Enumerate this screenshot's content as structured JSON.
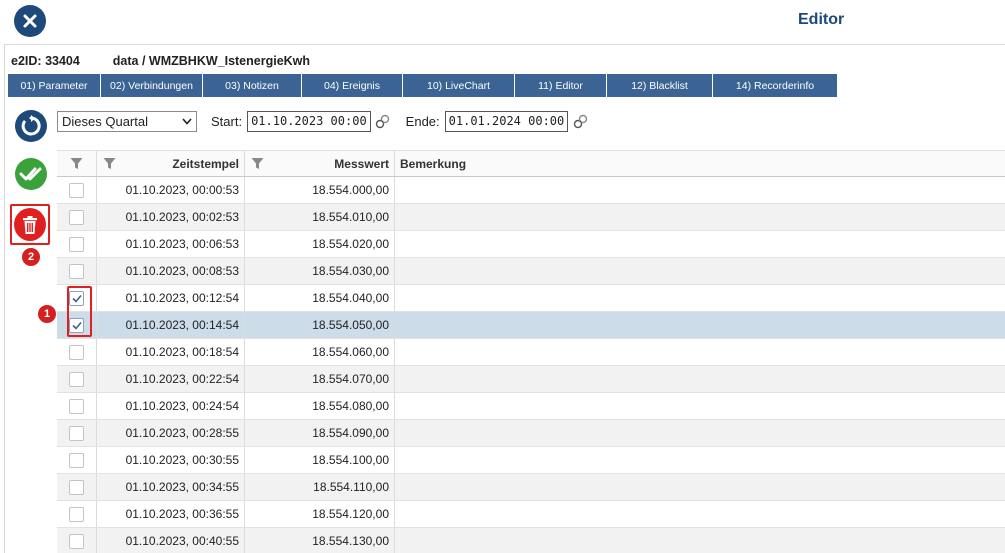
{
  "window": {
    "title": "Editor"
  },
  "record": {
    "id_label": "e2ID:",
    "id_value": "33404",
    "path": "data / WMZBHKW_IstenergieKwh"
  },
  "tabs": [
    {
      "label": "01) Parameter",
      "width": 93
    },
    {
      "label": "02) Verbindungen",
      "width": 102
    },
    {
      "label": "03) Notizen",
      "width": 99
    },
    {
      "label": "04) Ereignis",
      "width": 101
    },
    {
      "label": "10) LiveChart",
      "width": 112
    },
    {
      "label": "11) Editor",
      "width": 92
    },
    {
      "label": "12) Blacklist",
      "width": 106
    },
    {
      "label": "14) Recorderinfo",
      "width": 125
    }
  ],
  "filter": {
    "period": "Dieses Quartal",
    "start_label": "Start:",
    "start_value": "01.10.2023 00:00",
    "end_label": "Ende:",
    "end_value": "01.01.2024 00:00"
  },
  "columns": {
    "timestamp": "Zeitstempel",
    "value": "Messwert",
    "note": "Bemerkung"
  },
  "rows": [
    {
      "ts": "01.10.2023, 00:00:53",
      "val": "18.554.000,00",
      "note": "",
      "checked": false
    },
    {
      "ts": "01.10.2023, 00:02:53",
      "val": "18.554.010,00",
      "note": "",
      "checked": false
    },
    {
      "ts": "01.10.2023, 00:06:53",
      "val": "18.554.020,00",
      "note": "",
      "checked": false
    },
    {
      "ts": "01.10.2023, 00:08:53",
      "val": "18.554.030,00",
      "note": "",
      "checked": false
    },
    {
      "ts": "01.10.2023, 00:12:54",
      "val": "18.554.040,00",
      "note": "",
      "checked": true
    },
    {
      "ts": "01.10.2023, 00:14:54",
      "val": "18.554.050,00",
      "note": "",
      "checked": true,
      "selected": true
    },
    {
      "ts": "01.10.2023, 00:18:54",
      "val": "18.554.060,00",
      "note": "",
      "checked": false
    },
    {
      "ts": "01.10.2023, 00:22:54",
      "val": "18.554.070,00",
      "note": "",
      "checked": false
    },
    {
      "ts": "01.10.2023, 00:24:54",
      "val": "18.554.080,00",
      "note": "",
      "checked": false
    },
    {
      "ts": "01.10.2023, 00:28:55",
      "val": "18.554.090,00",
      "note": "",
      "checked": false
    },
    {
      "ts": "01.10.2023, 00:30:55",
      "val": "18.554.100,00",
      "note": "",
      "checked": false
    },
    {
      "ts": "01.10.2023, 00:34:55",
      "val": "18.554.110,00",
      "note": "",
      "checked": false
    },
    {
      "ts": "01.10.2023, 00:36:55",
      "val": "18.554.120,00",
      "note": "",
      "checked": false
    },
    {
      "ts": "01.10.2023, 00:40:55",
      "val": "18.554.130,00",
      "note": "",
      "checked": false
    }
  ],
  "annotations": {
    "badge_1": "1",
    "badge_2": "2"
  },
  "icons": {
    "close": "close-icon",
    "refresh": "refresh-icon",
    "confirm": "double-check-icon",
    "delete": "trash-icon",
    "filter": "filter-funnel-icon",
    "calendar": "calendar-link-icon",
    "dropdown": "chevron-down-icon"
  },
  "colors": {
    "navy": "#1d4a7a",
    "tab": "#3b6394",
    "green": "#3aa23a",
    "red": "#e02020",
    "selected_row": "#cddce9"
  }
}
